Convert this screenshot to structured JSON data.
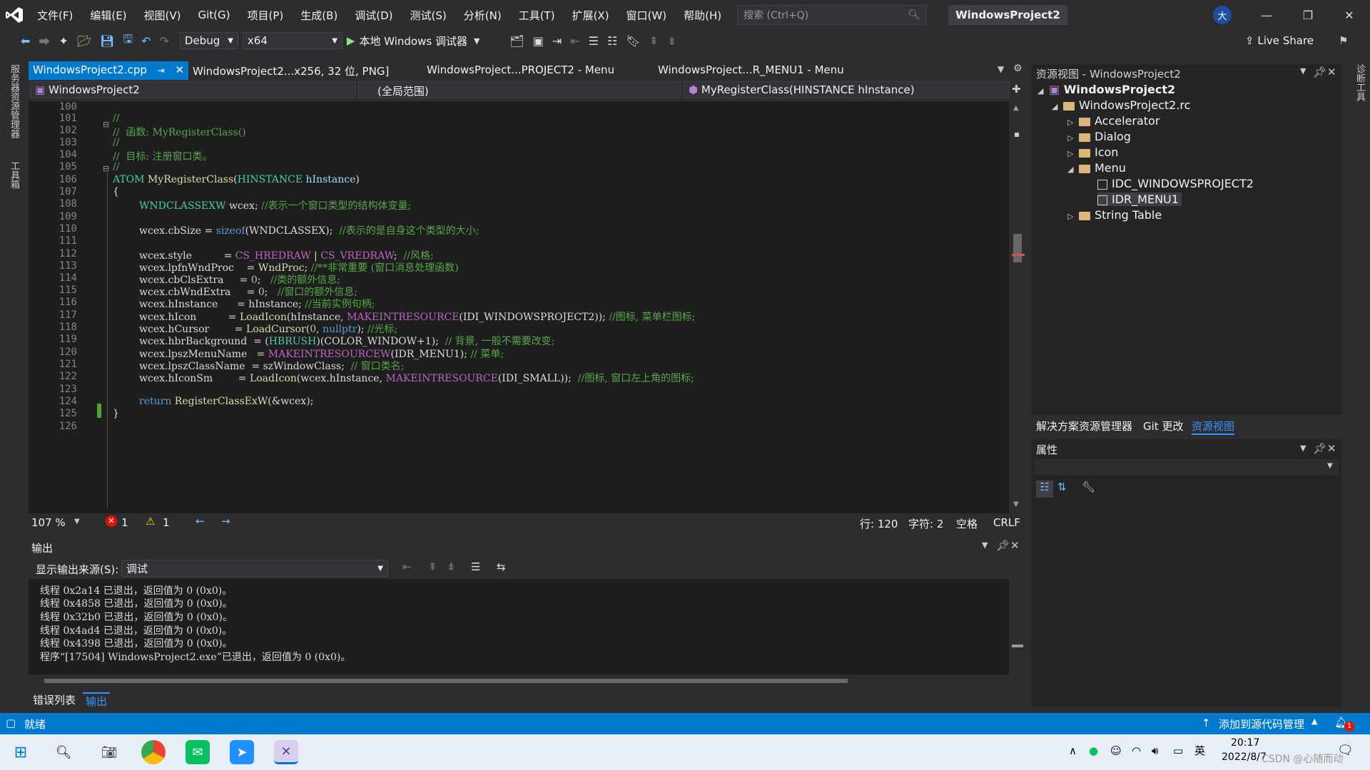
{
  "menu": [
    "文件(F)",
    "编辑(E)",
    "视图(V)",
    "Git(G)",
    "项目(P)",
    "生成(B)",
    "调试(D)",
    "测试(S)",
    "分析(N)",
    "工具(T)",
    "扩展(X)",
    "窗口(W)",
    "帮助(H)"
  ],
  "search_placeholder": "搜索 (Ctrl+Q)",
  "window_title": "WindowsProject2",
  "avatar": "大",
  "toolbar": {
    "config": "Debug",
    "platform": "x64",
    "run_label": "本地 Windows 调试器",
    "live_share": "Live Share"
  },
  "left_strip": [
    "服务器资源管理器",
    "工具箱"
  ],
  "right_strip": "诊断工具",
  "tabs": [
    "WindowsProject2.cpp",
    "WindowsProject2...x256, 32 位, PNG]",
    "WindowsProject...PROJECT2 - Menu",
    "WindowsProject...R_MENU1 - Menu"
  ],
  "nav": {
    "project": "WindowsProject2",
    "scope": "(全局范围)",
    "member": "MyRegisterClass(HINSTANCE hInstance)"
  },
  "line_numbers": [
    "100",
    "101",
    "102",
    "103",
    "104",
    "105",
    "106",
    "107",
    "108",
    "109",
    "110",
    "111",
    "112",
    "113",
    "114",
    "115",
    "116",
    "117",
    "118",
    "119",
    "120",
    "121",
    "122",
    "123",
    "124",
    "125",
    "126"
  ],
  "code": {
    "l101": "//",
    "l102": "//  函数: MyRegisterClass()",
    "l103": "//",
    "l104": "//  目标: 注册窗口类。",
    "l105": "//",
    "l106_kw": "ATOM",
    "l106_fn": "MyRegisterClass",
    "l106_ty": "HINSTANCE",
    "l106_var": "hInstance",
    "l107": "{",
    "l108_ty": "WNDCLASSEXW",
    "l108_rest": " wcex;",
    "l108_cm": "//表示一个窗口类型的结构体变量;",
    "l110_a": "wcex.cbSize = ",
    "l110_kw": "sizeof",
    "l110_b": "(WNDCLASSEX);",
    "l110_cm": "//表示的是自身这个类型的大小;",
    "l112_a": "wcex.style          = ",
    "l112_m1": "CS_HREDRAW",
    "l112_b": " | ",
    "l112_m2": "CS_VREDRAW",
    "l112_c": ";",
    "l112_cm": "//风格;",
    "l113_a": "wcex.lpfnWndProc    = ",
    "l113_fn": "WndProc",
    "l113_b": ";",
    "l113_cm": "//**非常重要 (窗口消息处理函数)",
    "l114_a": "wcex.cbClsExtra     = ",
    "l114_n": "0",
    "l114_b": ";",
    "l114_cm": "//类的额外信息;",
    "l115_a": "wcex.cbWndExtra     = ",
    "l115_n": "0",
    "l115_b": ";",
    "l115_cm": "//窗口的额外信息;",
    "l116_a": "wcex.hInstance      = hInstance;",
    "l116_cm": "//当前实例句柄;",
    "l117_a": "wcex.hIcon          = ",
    "l117_fn": "LoadIcon",
    "l117_b": "(hInstance, ",
    "l117_m": "MAKEINTRESOURCE",
    "l117_c": "(IDI_WINDOWSPROJECT2));",
    "l117_cm": "//图标, 菜单栏图标;",
    "l118_a": "wcex.hCursor        = ",
    "l118_fn": "LoadCursor",
    "l118_b": "(",
    "l118_n": "0",
    "l118_c": ", ",
    "l118_kw": "nullptr",
    "l118_d": ");",
    "l118_cm": "//光标;",
    "l119_a": "wcex.hbrBackground  = (",
    "l119_ty": "HBRUSH",
    "l119_b": ")(COLOR_WINDOW+1);",
    "l119_cm": "// 背景, 一般不需要改变;",
    "l120_a": "wcex.lpszMenuName   = ",
    "l120_m": "MAKEINTRESOURCEW",
    "l120_b": "(IDR_MENU1);",
    "l120_cm": "// 菜单;",
    "l121_a": "wcex.lpszClassName  = szWindowClass;",
    "l121_cm": "// 窗口类名;",
    "l122_a": "wcex.hIconSm        = ",
    "l122_fn": "LoadIcon",
    "l122_b": "(wcex.hInstance, ",
    "l122_m": "MAKEINTRESOURCE",
    "l122_c": "(IDI_SMALL));",
    "l122_cm": "//图标, 窗口左上角的图标;",
    "l124_kw": "return",
    "l124_fn": "RegisterClassExW",
    "l124_b": "(&wcex);",
    "l125": "}"
  },
  "editor_status": {
    "zoom": "107 %",
    "errors": "1",
    "warnings": "1",
    "line": "行: 120",
    "col": "字符: 2",
    "indent": "空格",
    "eol": "CRLF"
  },
  "output": {
    "title": "输出",
    "source_label": "显示输出来源(S):",
    "source_value": "调试",
    "lines": [
      "线程 0x2a14 已退出，返回值为 0 (0x0)。",
      "线程 0x4858 已退出，返回值为 0 (0x0)。",
      "线程 0x32b0 已退出，返回值为 0 (0x0)。",
      "线程 0x4ad4 已退出，返回值为 0 (0x0)。",
      "线程 0x4398 已退出，返回值为 0 (0x0)。",
      "程序“[17504] WindowsProject2.exe”已退出，返回值为 0 (0x0)。"
    ],
    "tab_errors": "错误列表",
    "tab_output": "输出"
  },
  "resource_view": {
    "title": "资源视图 - WindowsProject2",
    "root": "WindowsProject2",
    "rc": "WindowsProject2.rc",
    "items": [
      "Accelerator",
      "Dialog",
      "Icon",
      "Menu",
      "String Table"
    ],
    "menu_items": [
      "IDC_WINDOWSPROJECT2",
      "IDR_MENU1"
    ]
  },
  "right_tabs": [
    "解决方案资源管理器",
    "Git 更改",
    "资源视图"
  ],
  "properties_title": "属性",
  "status": {
    "ready": "就绪",
    "source_control": "添加到源代码管理",
    "notifications": "1"
  },
  "taskbar": {
    "ime": "英",
    "time": "20:17",
    "date": "2022/8/7",
    "watermark": "CSDN @心随而动"
  }
}
